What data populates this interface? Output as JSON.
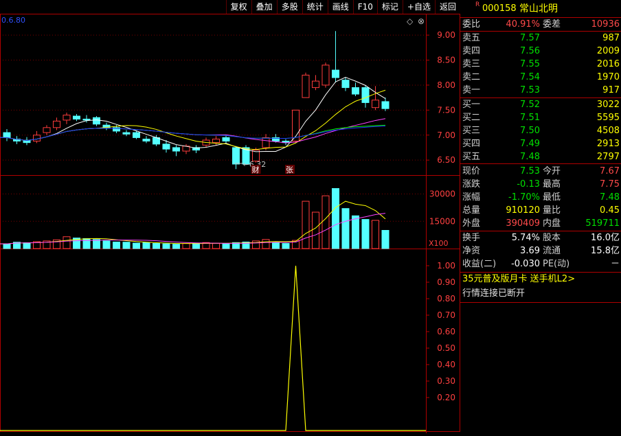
{
  "toolbar": [
    "复权",
    "叠加",
    "多股",
    "统计",
    "画线",
    "F10",
    "标记",
    "+自选",
    "返回"
  ],
  "chart_header": {
    "ma_label": "0.6.80"
  },
  "price_axis": [
    "9.00",
    "8.50",
    "8.00",
    "7.50",
    "7.00",
    "6.50"
  ],
  "volume_axis": [
    "30000",
    "15000"
  ],
  "volume_unit": "X100",
  "indicator_axis": [
    "1.00",
    "0.90",
    "0.80",
    "0.70",
    "0.60",
    "0.50",
    "0.40",
    "0.30",
    "0.20"
  ],
  "low_marker": "6.32",
  "event_tags": [
    "财",
    "张"
  ],
  "chart_data": {
    "type": "candlestick",
    "candles": [
      {
        "o": 7.05,
        "c": 6.95,
        "h": 7.12,
        "l": 6.88
      },
      {
        "o": 6.92,
        "c": 6.88,
        "h": 6.98,
        "l": 6.82
      },
      {
        "o": 6.9,
        "c": 6.85,
        "h": 6.96,
        "l": 6.8
      },
      {
        "o": 6.88,
        "c": 7.0,
        "h": 7.08,
        "l": 6.84
      },
      {
        "o": 7.05,
        "c": 7.15,
        "h": 7.2,
        "l": 7.0
      },
      {
        "o": 7.15,
        "c": 7.28,
        "h": 7.35,
        "l": 7.1
      },
      {
        "o": 7.3,
        "c": 7.4,
        "h": 7.45,
        "l": 7.22
      },
      {
        "o": 7.38,
        "c": 7.32,
        "h": 7.42,
        "l": 7.28
      },
      {
        "o": 7.32,
        "c": 7.3,
        "h": 7.4,
        "l": 7.25
      },
      {
        "o": 7.35,
        "c": 7.22,
        "h": 7.38,
        "l": 7.18
      },
      {
        "o": 7.2,
        "c": 7.15,
        "h": 7.25,
        "l": 7.1
      },
      {
        "o": 7.15,
        "c": 7.08,
        "h": 7.2,
        "l": 7.04
      },
      {
        "o": 7.05,
        "c": 7.02,
        "h": 7.1,
        "l": 6.98
      },
      {
        "o": 7.05,
        "c": 6.95,
        "h": 7.08,
        "l": 6.92
      },
      {
        "o": 6.92,
        "c": 6.88,
        "h": 6.98,
        "l": 6.84
      },
      {
        "o": 6.95,
        "c": 6.82,
        "h": 7.0,
        "l": 6.78
      },
      {
        "o": 6.82,
        "c": 6.72,
        "h": 6.9,
        "l": 6.65
      },
      {
        "o": 6.75,
        "c": 6.68,
        "h": 6.8,
        "l": 6.58
      },
      {
        "o": 6.68,
        "c": 6.78,
        "h": 6.82,
        "l": 6.62
      },
      {
        "o": 6.75,
        "c": 6.7,
        "h": 6.8,
        "l": 6.64
      },
      {
        "o": 6.8,
        "c": 6.9,
        "h": 6.95,
        "l": 6.75
      },
      {
        "o": 6.85,
        "c": 6.92,
        "h": 6.98,
        "l": 6.8
      },
      {
        "o": 6.95,
        "c": 6.88,
        "h": 7.0,
        "l": 6.82
      },
      {
        "o": 6.75,
        "c": 6.42,
        "h": 6.78,
        "l": 6.32
      },
      {
        "o": 6.75,
        "c": 6.42,
        "h": 6.8,
        "l": 6.4
      },
      {
        "o": 6.48,
        "c": 6.7,
        "h": 6.75,
        "l": 6.45
      },
      {
        "o": 6.75,
        "c": 6.95,
        "h": 7.02,
        "l": 6.7
      },
      {
        "o": 6.95,
        "c": 6.88,
        "h": 7.02,
        "l": 6.85
      },
      {
        "o": 6.88,
        "c": 6.85,
        "h": 6.92,
        "l": 6.8
      },
      {
        "o": 6.88,
        "c": 7.5,
        "h": 7.5,
        "l": 6.85
      },
      {
        "o": 7.75,
        "c": 8.2,
        "h": 8.25,
        "l": 7.75
      },
      {
        "o": 7.95,
        "c": 8.08,
        "h": 8.2,
        "l": 7.9
      },
      {
        "o": 8.0,
        "c": 8.4,
        "h": 8.45,
        "l": 7.95
      },
      {
        "o": 8.3,
        "c": 8.15,
        "h": 9.08,
        "l": 8.05
      },
      {
        "o": 8.1,
        "c": 7.95,
        "h": 8.15,
        "l": 7.88
      },
      {
        "o": 7.95,
        "c": 7.82,
        "h": 8.05,
        "l": 7.78
      },
      {
        "o": 7.95,
        "c": 7.65,
        "h": 8.0,
        "l": 7.55
      },
      {
        "o": 7.55,
        "c": 7.7,
        "h": 7.98,
        "l": 7.5
      },
      {
        "o": 7.67,
        "c": 7.53,
        "h": 7.75,
        "l": 7.48
      }
    ],
    "volume": [
      2600,
      3500,
      3200,
      3800,
      4200,
      4800,
      6500,
      5800,
      5500,
      5000,
      4200,
      3600,
      3500,
      3000,
      3200,
      2800,
      2600,
      2400,
      2800,
      3000,
      3300,
      2900,
      2600,
      3300,
      3600,
      4200,
      5000,
      3200,
      2800,
      4500,
      26000,
      20000,
      29000,
      33000,
      22000,
      18000,
      16000,
      15500,
      10000
    ],
    "price_ylim": [
      6.2,
      9.4
    ],
    "volume_ylim": [
      0,
      40000
    ],
    "indicator_ylim": [
      0,
      1.1
    ],
    "indicator_peak_index": 29
  },
  "stock": {
    "badge": "R",
    "code": "000158",
    "name": "常山北明"
  },
  "weibi": {
    "label": "委比",
    "value": "40.91%",
    "label2": "委差",
    "value2": "10936"
  },
  "asks": [
    {
      "label": "卖五",
      "price": "7.57",
      "vol": "987"
    },
    {
      "label": "卖四",
      "price": "7.56",
      "vol": "2009"
    },
    {
      "label": "卖三",
      "price": "7.55",
      "vol": "2016"
    },
    {
      "label": "卖二",
      "price": "7.54",
      "vol": "1970"
    },
    {
      "label": "卖一",
      "price": "7.53",
      "vol": "917"
    }
  ],
  "bids": [
    {
      "label": "买一",
      "price": "7.52",
      "vol": "3022"
    },
    {
      "label": "买二",
      "price": "7.51",
      "vol": "5595"
    },
    {
      "label": "买三",
      "price": "7.50",
      "vol": "4508"
    },
    {
      "label": "买四",
      "price": "7.49",
      "vol": "2913"
    },
    {
      "label": "买五",
      "price": "7.48",
      "vol": "2797"
    }
  ],
  "quote": [
    {
      "l1": "现价",
      "v1": "7.53",
      "c1": "grn",
      "l2": "今开",
      "v2": "7.67",
      "c2": "red"
    },
    {
      "l1": "涨跌",
      "v1": "-0.13",
      "c1": "grn",
      "l2": "最高",
      "v2": "7.75",
      "c2": "red"
    },
    {
      "l1": "涨幅",
      "v1": "-1.70%",
      "c1": "grn",
      "l2": "最低",
      "v2": "7.48",
      "c2": "grn"
    },
    {
      "l1": "总量",
      "v1": "910120",
      "c1": "yel",
      "l2": "量比",
      "v2": "0.45",
      "c2": "yel"
    },
    {
      "l1": "外盘",
      "v1": "390409",
      "c1": "red",
      "l2": "内盘",
      "v2": "519711",
      "c2": "grn"
    }
  ],
  "fund": [
    {
      "l1": "换手",
      "v1": "5.74%",
      "l2": "股本",
      "v2": "16.0亿"
    },
    {
      "l1": "净资",
      "v1": "3.69",
      "l2": "流通",
      "v2": "15.8亿"
    },
    {
      "l1": "收益(二)",
      "v1": "-0.030",
      "l2": "PE(动)",
      "v2": "－"
    }
  ],
  "promo": "35元普及版月卡 送手机L2>",
  "status": "行情连接已断开",
  "colors": {
    "up": "#ff3c3c",
    "down": "#54ffff",
    "grid": "#b00000",
    "ma5": "#ffffff",
    "ma10": "#ffff00",
    "ma20": "#ff44ff",
    "ma30": "#00ff00",
    "ma60": "#2030ff"
  }
}
